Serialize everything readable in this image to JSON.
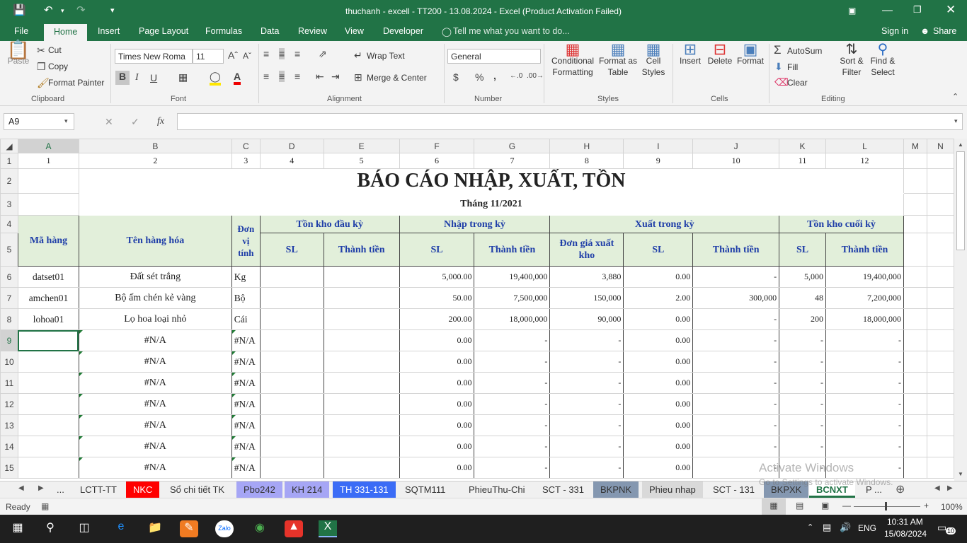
{
  "window": {
    "title": "thuchanh - excell - TT200 - 13.08.2024 - Excel (Product Activation Failed)"
  },
  "tabs": [
    "File",
    "Home",
    "Insert",
    "Page Layout",
    "Formulas",
    "Data",
    "Review",
    "View",
    "Developer"
  ],
  "tell_me": "Tell me what you want to do...",
  "sign_in": "Sign in",
  "share": "Share",
  "clipboard": {
    "paste": "Paste",
    "cut": "Cut",
    "copy": "Copy",
    "format_painter": "Format Painter",
    "group": "Clipboard"
  },
  "font": {
    "name": "Times New Roma",
    "size": "11",
    "group": "Font",
    "bold": "B",
    "italic": "I",
    "underline": "U"
  },
  "alignment": {
    "wrap": "Wrap Text",
    "merge": "Merge & Center",
    "group": "Alignment"
  },
  "number": {
    "format": "General",
    "group": "Number",
    "dollar": "$",
    "percent": "%",
    "comma": ","
  },
  "styles": {
    "conditional1": "Conditional",
    "conditional2": "Formatting",
    "format_as1": "Format as",
    "format_as2": "Table",
    "cell1": "Cell",
    "cell2": "Styles",
    "group": "Styles"
  },
  "cells": {
    "insert": "Insert",
    "delete": "Delete",
    "format": "Format",
    "group": "Cells"
  },
  "editing": {
    "autosum": "AutoSum",
    "fill": "Fill",
    "clear": "Clear",
    "sort1": "Sort &",
    "sort2": "Filter",
    "find1": "Find &",
    "find2": "Select",
    "group": "Editing"
  },
  "namebox": "A9",
  "columns": [
    "A",
    "B",
    "C",
    "D",
    "E",
    "F",
    "G",
    "H",
    "I",
    "J",
    "K",
    "L",
    "M",
    "N"
  ],
  "row1": [
    "1",
    "2",
    "3",
    "4",
    "5",
    "6",
    "7",
    "8",
    "9",
    "10",
    "11",
    "12"
  ],
  "report": {
    "title": "BÁO CÁO NHẬP, XUẤT, TỒN",
    "month": "Tháng 11/2021"
  },
  "headers": {
    "ma_hang": "Mã hàng",
    "ten_hang": "Tên hàng hóa",
    "dvt": "Đơn vị tính",
    "ton_dau": "Tồn kho đầu kỳ",
    "nhap": "Nhập trong kỳ",
    "xuat": "Xuất trong kỳ",
    "ton_cuoi": "Tồn kho cuối kỳ",
    "sl": "SL",
    "thanh_tien": "Thành tiền",
    "don_gia": "Đơn giá xuất kho"
  },
  "rows": [
    [
      "datset01",
      "Đất sét trắng",
      "Kg",
      "",
      "",
      "5,000.00",
      "19,400,000",
      "3,880",
      "0.00",
      "-",
      "5,000",
      "19,400,000"
    ],
    [
      "amchen01",
      "Bộ ấm chén kẻ vàng",
      "Bộ",
      "",
      "",
      "50.00",
      "7,500,000",
      "150,000",
      "2.00",
      "300,000",
      "48",
      "7,200,000"
    ],
    [
      "lohoa01",
      "Lọ hoa loại nhỏ",
      "Cái",
      "",
      "",
      "200.00",
      "18,000,000",
      "90,000",
      "0.00",
      "-",
      "200",
      "18,000,000"
    ],
    [
      "",
      "#N/A",
      "#N/A",
      "",
      "",
      "0.00",
      "-",
      "-",
      "0.00",
      "-",
      "-",
      "-"
    ],
    [
      "",
      "#N/A",
      "#N/A",
      "",
      "",
      "0.00",
      "-",
      "-",
      "0.00",
      "-",
      "-",
      "-"
    ],
    [
      "",
      "#N/A",
      "#N/A",
      "",
      "",
      "0.00",
      "-",
      "-",
      "0.00",
      "-",
      "-",
      "-"
    ],
    [
      "",
      "#N/A",
      "#N/A",
      "",
      "",
      "0.00",
      "-",
      "-",
      "0.00",
      "-",
      "-",
      "-"
    ],
    [
      "",
      "#N/A",
      "#N/A",
      "",
      "",
      "0.00",
      "-",
      "-",
      "0.00",
      "-",
      "-",
      "-"
    ],
    [
      "",
      "#N/A",
      "#N/A",
      "",
      "",
      "0.00",
      "-",
      "-",
      "0.00",
      "-",
      "-",
      "-"
    ],
    [
      "",
      "#N/A",
      "#N/A",
      "",
      "",
      "0.00",
      "-",
      "-",
      "0.00",
      "-",
      "-",
      "-"
    ]
  ],
  "sheet_tabs": [
    "...",
    "LCTT-TT",
    "NKC",
    "Sổ chi tiết TK",
    "Pbo242",
    "KH 214",
    "TH 331-131",
    "SQTM111",
    "PhieuThu-Chi",
    "SCT - 331",
    "BKPNK",
    "Phieu nhap",
    "SCT - 131",
    "BKPXK",
    "BCNXT",
    "P ..."
  ],
  "status": {
    "ready": "Ready",
    "zoom": "100%"
  },
  "watermark": {
    "line1": "Activate Windows",
    "line2": "Go to Settings to activate Windows."
  },
  "taskbar": {
    "time": "10:31 AM",
    "date": "15/08/2024",
    "lang": "ENG",
    "notif": "10"
  }
}
